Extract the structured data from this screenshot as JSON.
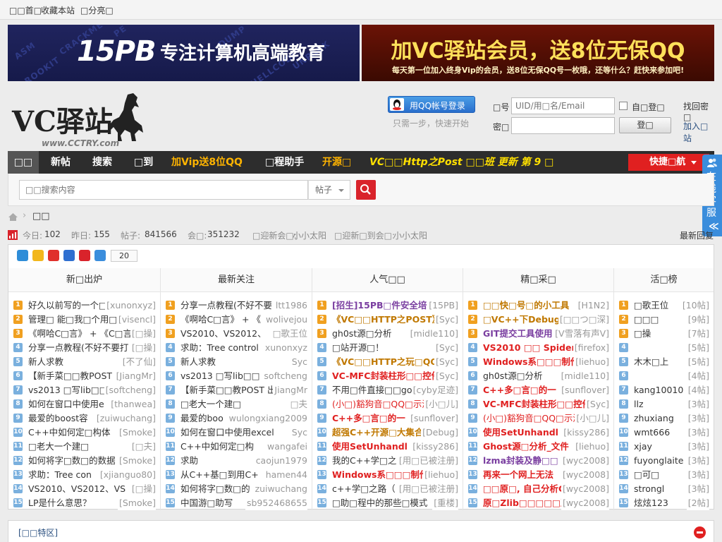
{
  "topbar": {
    "home": "□□首□",
    "favorite": "收藏本站",
    "share": "□分亮□"
  },
  "banner_left": {
    "logo": "15PB",
    "slogan": "专注计算机高端教育",
    "watermarks": [
      "ASM",
      "CRACKME",
      "PE",
      "DUMP",
      "ROOKIT",
      "SHELLCODE",
      "UNPACK"
    ]
  },
  "banner_right": {
    "headline": "加VC驿站会员，送8位无保QQ",
    "sub": "每天第一位加入终身Vip的会员，送8位无保QQ号一枚哦，还等什么？赶快来参加吧!"
  },
  "header": {
    "logo_text": "VC驿站",
    "logo_url": "www.CCTRY.com",
    "qq_login": "用QQ帐号登录",
    "qq_hint": "只需一步，快速开始",
    "account_label": "□号",
    "account_placeholder": "UID/用□名/Email",
    "password_label": "密□",
    "autologin": "自□登□",
    "login_button": "登□",
    "forgot": "找回密□",
    "register": "加入□站"
  },
  "nav": {
    "items": [
      {
        "label": "□□",
        "color": "#ffffff"
      },
      {
        "label": "新帖",
        "color": "#ffffff"
      },
      {
        "label": "搜索",
        "color": "#ffffff"
      },
      {
        "label": "□到",
        "color": "#ffffff"
      },
      {
        "label": "加Vip送8位QQ",
        "color": "#ffb400"
      },
      {
        "label": "□程助手",
        "color": "#ffffff"
      },
      {
        "label": "开源□",
        "color": "#ffb400"
      },
      {
        "label": "VC□□Http之Post □□班 更新 第 9 □",
        "color": "#ffe000"
      }
    ],
    "quick_nav": "快捷□航"
  },
  "kefu": {
    "label": "在线客服",
    "arrows": "≪"
  },
  "search": {
    "placeholder": "□□搜索内容",
    "type": "帖子"
  },
  "breadcrumb": {
    "current": "□□"
  },
  "stats": {
    "today_label": "今日:",
    "today": "102",
    "yesterday_label": "昨日:",
    "yesterday": "155",
    "posts_label": "帖子:",
    "posts": "841566",
    "members_label": "会□:",
    "members": "351232",
    "welcome_label": "□迎新会□:",
    "welcome_user": "小小太阳",
    "checkin_label": "□迎新□到会□:",
    "checkin_user": "小小太阳",
    "latest": "最新回复"
  },
  "share_count": "20",
  "colors": {
    "accent": "#e02020",
    "link_blue": "#2a4f7f",
    "badge_top3": "#f0a020",
    "badge_rest": "#7ab0de"
  },
  "columns": [
    {
      "title": "新□出炉",
      "rows": [
        {
          "title": "好久以前写的一个□",
          "aux": "[xunonxyz]",
          "color": "#333333"
        },
        {
          "title": "管理□ 能□我□个用□名",
          "aux": "[visencl]",
          "color": "#333333"
        },
        {
          "title": "《啊哈C□言》 + 《C□言",
          "aux": "[□操]",
          "color": "#333333"
        },
        {
          "title": "分享一点教程(不好不要打",
          "aux": "[□操]",
          "color": "#333333"
        },
        {
          "title": "新人求教",
          "aux": "[不了仙]",
          "color": "#333333"
        },
        {
          "title": "【新手菜□□教POST",
          "aux": "[JiangMr]",
          "color": "#333333"
        },
        {
          "title": "vs2013 □写lib□□",
          "aux": "[softcheng]",
          "color": "#333333"
        },
        {
          "title": "如何在窗口中使用e",
          "aux": "[thanwea]",
          "color": "#333333"
        },
        {
          "title": "最爱的boost容",
          "aux": "[zuiwuchang]",
          "color": "#333333"
        },
        {
          "title": "C++中如何定□构体",
          "aux": "[Smoke]",
          "color": "#333333"
        },
        {
          "title": "□老大一个建□",
          "aux": "[□夫]",
          "color": "#333333"
        },
        {
          "title": "如何将字□数□的数据",
          "aux": "[Smoke]",
          "color": "#333333"
        },
        {
          "title": "求助：Tree con",
          "aux": "[xjianguo80]",
          "color": "#333333"
        },
        {
          "title": "VS2010、VS2012、VS",
          "aux": "[□操]",
          "color": "#333333"
        },
        {
          "title": "LP是什么意思？",
          "aux": "[Smoke]",
          "color": "#333333"
        }
      ]
    },
    {
      "title": "最新关注",
      "rows": [
        {
          "title": "分享一点教程(不好不要",
          "aux": "ltt1986",
          "color": "#333333"
        },
        {
          "title": "《啊哈C□言》 + 《",
          "aux": "wolivejou",
          "color": "#333333"
        },
        {
          "title": "VS2010、VS2012、",
          "aux": "□歌王位",
          "color": "#333333"
        },
        {
          "title": "求助：Tree control",
          "aux": "xunonxyz",
          "color": "#333333"
        },
        {
          "title": "新人求教",
          "aux": "Syc",
          "color": "#333333"
        },
        {
          "title": "vs2013 □写lib□□",
          "aux": "softcheng",
          "color": "#333333"
        },
        {
          "title": "【新手菜□□教POST 出",
          "aux": "JiangMr",
          "color": "#333333"
        },
        {
          "title": "□老大一个建□",
          "aux": "□夫",
          "color": "#333333"
        },
        {
          "title": "最爱的boo",
          "aux": "wulongxiang2009",
          "color": "#333333"
        },
        {
          "title": "如何在窗口中使用excel",
          "aux": "Syc",
          "color": "#333333"
        },
        {
          "title": "C++中如何定□构",
          "aux": "wangafei",
          "color": "#333333"
        },
        {
          "title": "求助",
          "aux": "caojun1979",
          "color": "#333333"
        },
        {
          "title": "从C++基□到用C+",
          "aux": "hamen44",
          "color": "#333333"
        },
        {
          "title": "如何将字□数□的",
          "aux": "zuiwuchang",
          "color": "#333333"
        },
        {
          "title": "中国游□助写",
          "aux": "sb952468655",
          "color": "#333333"
        }
      ]
    },
    {
      "title": "人气□□",
      "rows": [
        {
          "title": "[招生]15PB□件安全培□",
          "aux": "[15PB]",
          "color": "#7a3ea0",
          "bold": true
        },
        {
          "title": "《VC□□HTTP之POST》",
          "aux": "[Syc]",
          "color": "#c07800",
          "bold": true
        },
        {
          "title": "gh0st源□分析",
          "aux": "[midle110]",
          "color": "#333333"
        },
        {
          "title": "□站开源□！",
          "aux": "[Syc]",
          "color": "#333333"
        },
        {
          "title": "《VC□□HTTP之玩□QQ",
          "aux": "[Syc]",
          "color": "#c07800",
          "bold": true
        },
        {
          "title": "VC-MFC封装柱形□□控件",
          "aux": "[Syc]",
          "color": "#e02020",
          "bold": true
        },
        {
          "title": "不用□件直接□□goo",
          "aux": "[cyby足迹]",
          "color": "#333333"
        },
        {
          "title": "(小□)豁狗音□QQ□示源",
          "aux": "[小□儿]",
          "color": "#e02020"
        },
        {
          "title": "C++多□言□的一",
          "aux": "[sunflover]",
          "color": "#e02020",
          "bold": true
        },
        {
          "title": "超强C++开源□大集合",
          "aux": "[Debug]",
          "color": "#c07800",
          "bold": true
        },
        {
          "title": "使用SetUnhandl",
          "aux": "[kissy286]",
          "color": "#e02020",
          "bold": true
        },
        {
          "title": "我的C++学□之",
          "aux": "[用□已被注册]",
          "color": "#333333"
        },
        {
          "title": "Windows系□□□制作",
          "aux": "[liehuo]",
          "color": "#e02020",
          "bold": true
        },
        {
          "title": "c++学□之路（",
          "aux": "[用□已被注册]",
          "color": "#333333"
        },
        {
          "title": "□助□程中的那些□模式",
          "aux": "[重楼]",
          "color": "#333333"
        }
      ]
    },
    {
      "title": "精□采□",
      "rows": [
        {
          "title": "□□快□号□的小工具",
          "aux": "[H1N2]",
          "color": "#c07800",
          "bold": true
        },
        {
          "title": "□VC++下Debug模",
          "aux": "[□□つ□深]",
          "color": "#c07800",
          "bold": true
        },
        {
          "title": "GIT提交工具使用",
          "aux": "[V雪落有声V]",
          "color": "#7a3ea0",
          "bold": true
        },
        {
          "title": "VS2010 □□ Spider",
          "aux": "[firefox]",
          "color": "#e02020",
          "bold": true
        },
        {
          "title": "Windows系□□□制作",
          "aux": "[liehuo]",
          "color": "#e02020",
          "bold": true
        },
        {
          "title": "gh0st源□分析",
          "aux": "[midle110]",
          "color": "#333333"
        },
        {
          "title": "C++多□言□的一",
          "aux": "[sunflover]",
          "color": "#e02020",
          "bold": true
        },
        {
          "title": "VC-MFC封装柱形□□控件",
          "aux": "[Syc]",
          "color": "#e02020",
          "bold": true
        },
        {
          "title": "(小□)豁狗音□QQ□示源",
          "aux": "[小□儿]",
          "color": "#e02020"
        },
        {
          "title": "使用SetUnhandl",
          "aux": "[kissy286]",
          "color": "#e02020",
          "bold": true
        },
        {
          "title": "Ghost源□分析_文件",
          "aux": "[liehuo]",
          "color": "#e02020",
          "bold": true
        },
        {
          "title": "lzma封装及静□□",
          "aux": "[wyc2008]",
          "color": "#7a3ea0",
          "bold": true
        },
        {
          "title": "再来一个网上无法",
          "aux": "[wyc2008]",
          "color": "#e02020",
          "bold": true
        },
        {
          "title": "□□原□, 自己分析G",
          "aux": "[wyc2008]",
          "color": "#e02020",
          "bold": true
        },
        {
          "title": "原□Zlib□□□□□及使",
          "aux": "[wyc2008]",
          "color": "#e02020",
          "bold": true
        }
      ]
    },
    {
      "title": "活□榜",
      "rows": [
        {
          "title": "□歌王位",
          "aux": "[10帖]",
          "color": "#333333"
        },
        {
          "title": "□□□",
          "aux": "[9帖]",
          "color": "#333333"
        },
        {
          "title": "□操",
          "aux": "[7帖]",
          "color": "#333333"
        },
        {
          "title": "",
          "aux": "[5帖]",
          "color": "#333333"
        },
        {
          "title": "木木□上",
          "aux": "[5帖]",
          "color": "#333333"
        },
        {
          "title": "",
          "aux": "[4帖]",
          "color": "#333333"
        },
        {
          "title": "kang10010",
          "aux": "[4帖]",
          "color": "#333333"
        },
        {
          "title": "llz",
          "aux": "[3帖]",
          "color": "#333333"
        },
        {
          "title": "zhuxiang",
          "aux": "[3帖]",
          "color": "#333333"
        },
        {
          "title": "wmt666",
          "aux": "[3帖]",
          "color": "#333333"
        },
        {
          "title": "xjay",
          "aux": "[3帖]",
          "color": "#333333"
        },
        {
          "title": "fuyonglaite",
          "aux": "[3帖]",
          "color": "#333333"
        },
        {
          "title": "□可□",
          "aux": "[3帖]",
          "color": "#333333"
        },
        {
          "title": "strongl",
          "aux": "[3帖]",
          "color": "#333333"
        },
        {
          "title": "炫炫123",
          "aux": "[2帖]",
          "color": "#333333"
        }
      ]
    }
  ],
  "promo": {
    "label": "[□□特区]"
  }
}
